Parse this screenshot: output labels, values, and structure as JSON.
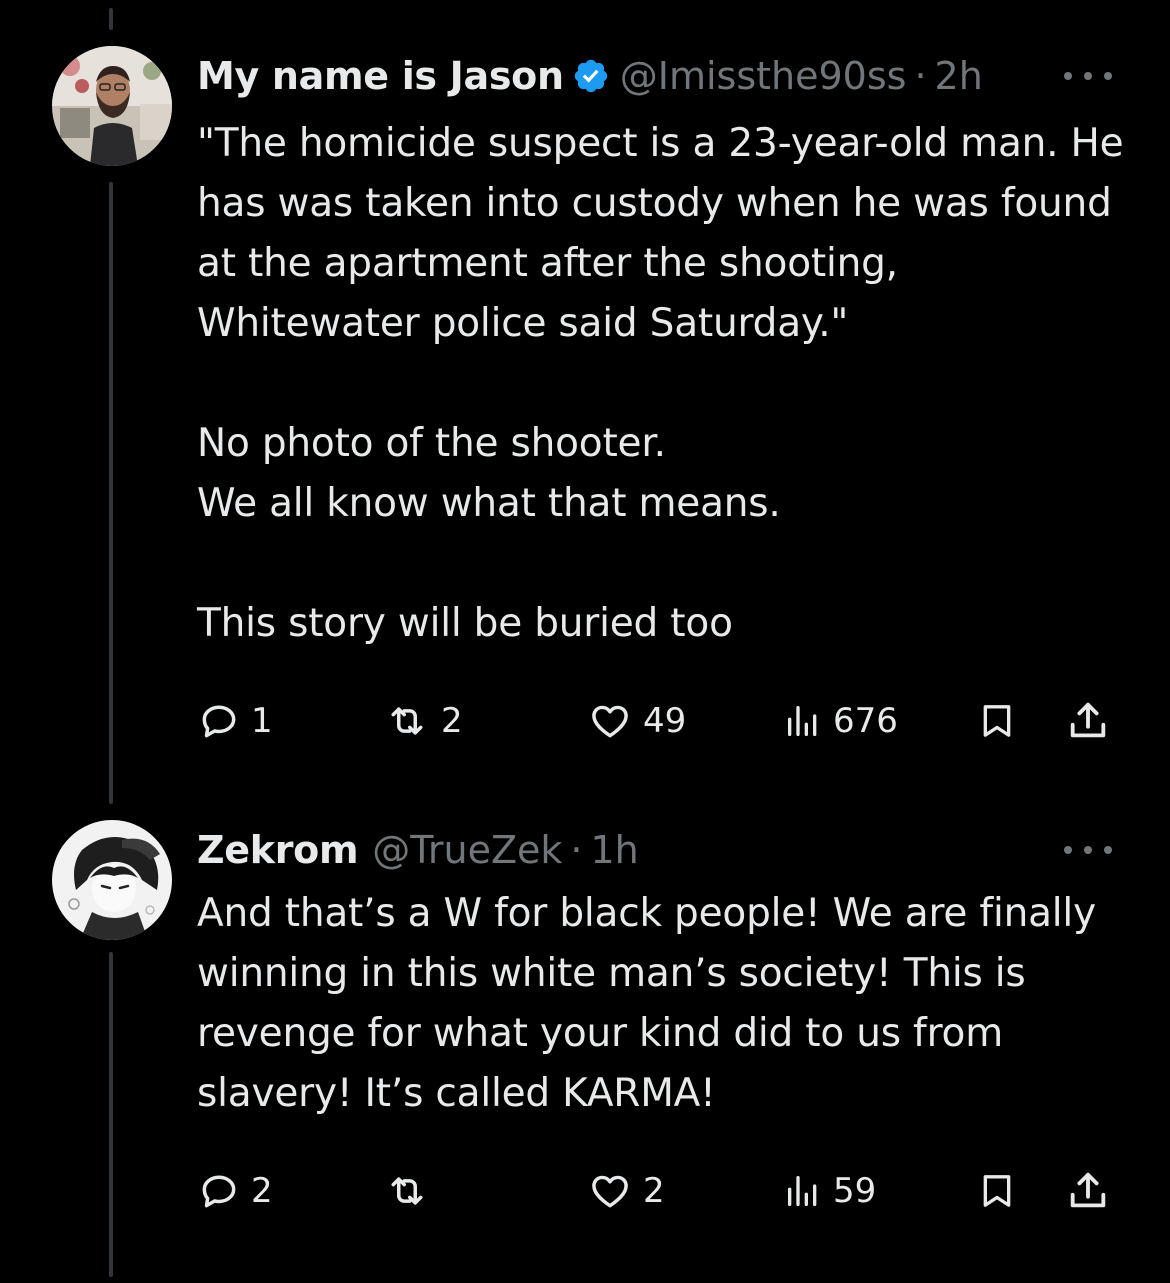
{
  "colors": {
    "background": "#000000",
    "text_primary": "#e7e9ea",
    "text_secondary": "#71767b",
    "verified_blue": "#1d9bf0",
    "thread_line": "#333639"
  },
  "tweets": [
    {
      "display_name": "My name is Jason",
      "verified": true,
      "handle": "@Imissthe90ss",
      "separator": "·",
      "time": "2h",
      "avatar_icon": "user-avatar-photo",
      "more_icon": "more-dots-icon",
      "text": "\"The homicide suspect is a 23-year-old man. He has was taken into custody when he was found at the apartment after the shooting, Whitewater police said Saturday.\"\n\nNo photo of the shooter.\nWe all know what that means.\n\nThis story will be buried too",
      "replies": "1",
      "retweets": "2",
      "likes": "49",
      "views": "676"
    },
    {
      "display_name": "Zekrom",
      "verified": false,
      "handle": "@TrueZek",
      "separator": "·",
      "time": "1h",
      "avatar_icon": "anime-avatar",
      "more_icon": "more-dots-icon",
      "text": "And that’s a W for black people! We are finally winning in this white man’s society! This is revenge for what your kind did to us from slavery! It’s called KARMA!",
      "replies": "2",
      "retweets": "",
      "likes": "2",
      "views": "59"
    }
  ]
}
